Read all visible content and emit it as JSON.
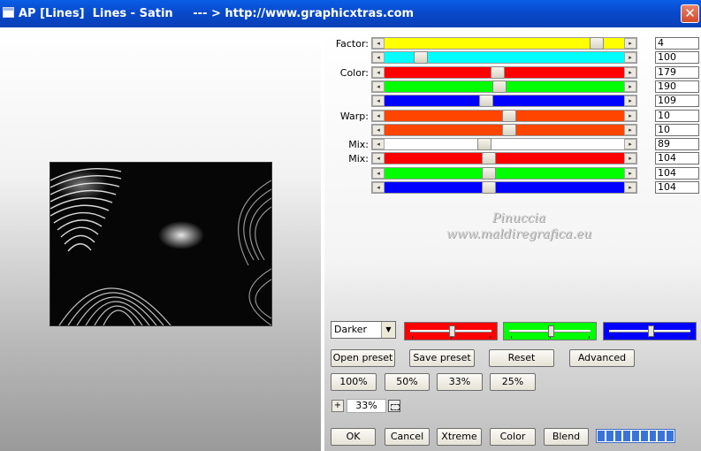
{
  "window": {
    "title": "AP [Lines]  Lines - Satin     --- > http://www.graphicxtras.com",
    "close_glyph": "✕"
  },
  "arrows": {
    "left": "◂",
    "right": "▸"
  },
  "sliders": [
    {
      "label": "Factor:",
      "value": "4",
      "color": "#ffff00",
      "position": 0.91
    },
    {
      "label": "",
      "value": "100",
      "color": "#00ffff",
      "position": 0.13
    },
    {
      "label": "Color:",
      "value": "179",
      "color": "#ff0000",
      "position": 0.47
    },
    {
      "label": "",
      "value": "190",
      "color": "#00ff00",
      "position": 0.48
    },
    {
      "label": "",
      "value": "109",
      "color": "#0000ff",
      "position": 0.42
    },
    {
      "label": "Warp:",
      "value": "10",
      "color": "#ff4500",
      "position": 0.52
    },
    {
      "label": "",
      "value": "10",
      "color": "#ff4500",
      "position": 0.52
    },
    {
      "label": "Mix:",
      "value": "89",
      "color": "#ffffff",
      "position": 0.41
    },
    {
      "label": "Mix:",
      "value": "104",
      "color": "#ff0000",
      "position": 0.43
    },
    {
      "label": "",
      "value": "104",
      "color": "#00ff00",
      "position": 0.43
    },
    {
      "label": "",
      "value": "104",
      "color": "#0000ff",
      "position": 0.43
    }
  ],
  "watermark": {
    "line1": "Pinuccia",
    "line2": "www.maldiregrafica.eu"
  },
  "blend_mode": {
    "selected": "Darker",
    "dropdown_glyph": "▼"
  },
  "channel_sliders": [
    {
      "color": "#ff0000",
      "position": 0.52
    },
    {
      "color": "#00ff00",
      "position": 0.52
    },
    {
      "color": "#0000ff",
      "position": 0.52
    }
  ],
  "preset_buttons": {
    "open": "Open preset",
    "save": "Save preset",
    "reset": "Reset",
    "advanced": "Advanced"
  },
  "zoom_buttons": [
    "100%",
    "50%",
    "33%",
    "25%"
  ],
  "zoom": {
    "plus_glyph": "+",
    "value": "33%"
  },
  "bottom_buttons": {
    "ok": "OK",
    "cancel": "Cancel",
    "xtreme": "Xtreme",
    "color": "Color",
    "blend": "Blend"
  },
  "progress": {
    "segments": 9,
    "fraction": 1.0
  }
}
